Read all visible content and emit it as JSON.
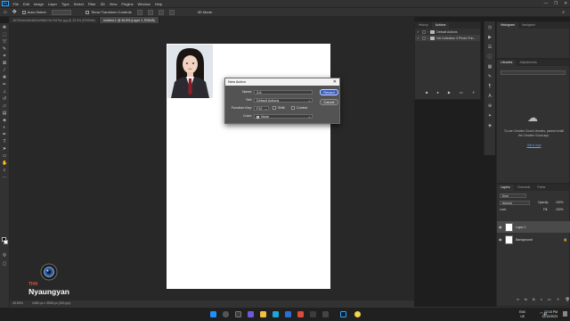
{
  "menubar": {
    "app_icon": "Ps",
    "items": [
      "File",
      "Edit",
      "Image",
      "Layer",
      "Type",
      "Select",
      "Filter",
      "3D",
      "View",
      "Plugins",
      "Window",
      "Help"
    ],
    "window_buttons": [
      "—",
      "❐",
      "✕"
    ]
  },
  "options": {
    "auto_select": "Auto-Select:",
    "show_transform": "Show Transform Controls",
    "mode_3d": "3D Mode:"
  },
  "tabs": [
    {
      "label": "467594c0a5ed8d2a986e7cb74d7be.jpg @ 33.3% (RGB/8#)",
      "active": false
    },
    {
      "label": "Untitled-1 @ 45.8% (Layer 1, RGB/8)",
      "active": true
    }
  ],
  "status": {
    "zoom": "45.83%",
    "doc_info": "2480 px x 3508 px (300 ppi)"
  },
  "watermark": {
    "brand": "Nyaungyan",
    "sub": "THH"
  },
  "dialog": {
    "title": "New Action",
    "name_label": "Name:",
    "name_value": "3-6",
    "set_label": "Set:",
    "set_value": "Default Actions",
    "key_label": "Function Key:",
    "key_value": "F12",
    "shift_label": "Shift",
    "control_label": "Control",
    "color_label": "Color:",
    "color_value": "None",
    "record_label": "Record",
    "cancel_label": "Cancel"
  },
  "history_panel": {
    "tabs": [
      "History",
      "Actions"
    ],
    "rows": [
      "Default Actions",
      "NA Collection 3 Photo Prin..."
    ]
  },
  "histogram_panel": {
    "tabs": [
      "Histogram",
      "Navigator"
    ]
  },
  "libraries_panel": {
    "tabs": [
      "Libraries",
      "Adjustments"
    ],
    "message": "To use Creative Cloud Libraries, please install the Creative Cloud app.",
    "link": "Get it now"
  },
  "layers_panel": {
    "tabs": [
      "Layers",
      "Channels",
      "Paths"
    ],
    "kind": "Kind",
    "blend": "Normal",
    "opacity_label": "Opacity:",
    "opacity": "100%",
    "lock_label": "Lock:",
    "fill_label": "Fill:",
    "fill": "100%",
    "layers": [
      "Layer 1",
      "Background"
    ]
  },
  "taskbar": {
    "lang_line1": "ENG",
    "lang_line2": "US",
    "time": "12:15 PM",
    "date": "12/12/2023"
  },
  "colors": {
    "accent": "#31a8ff",
    "record_button": "#3a5bbf",
    "dialog_bg": "#535353",
    "canvas_bg": "#282828"
  }
}
